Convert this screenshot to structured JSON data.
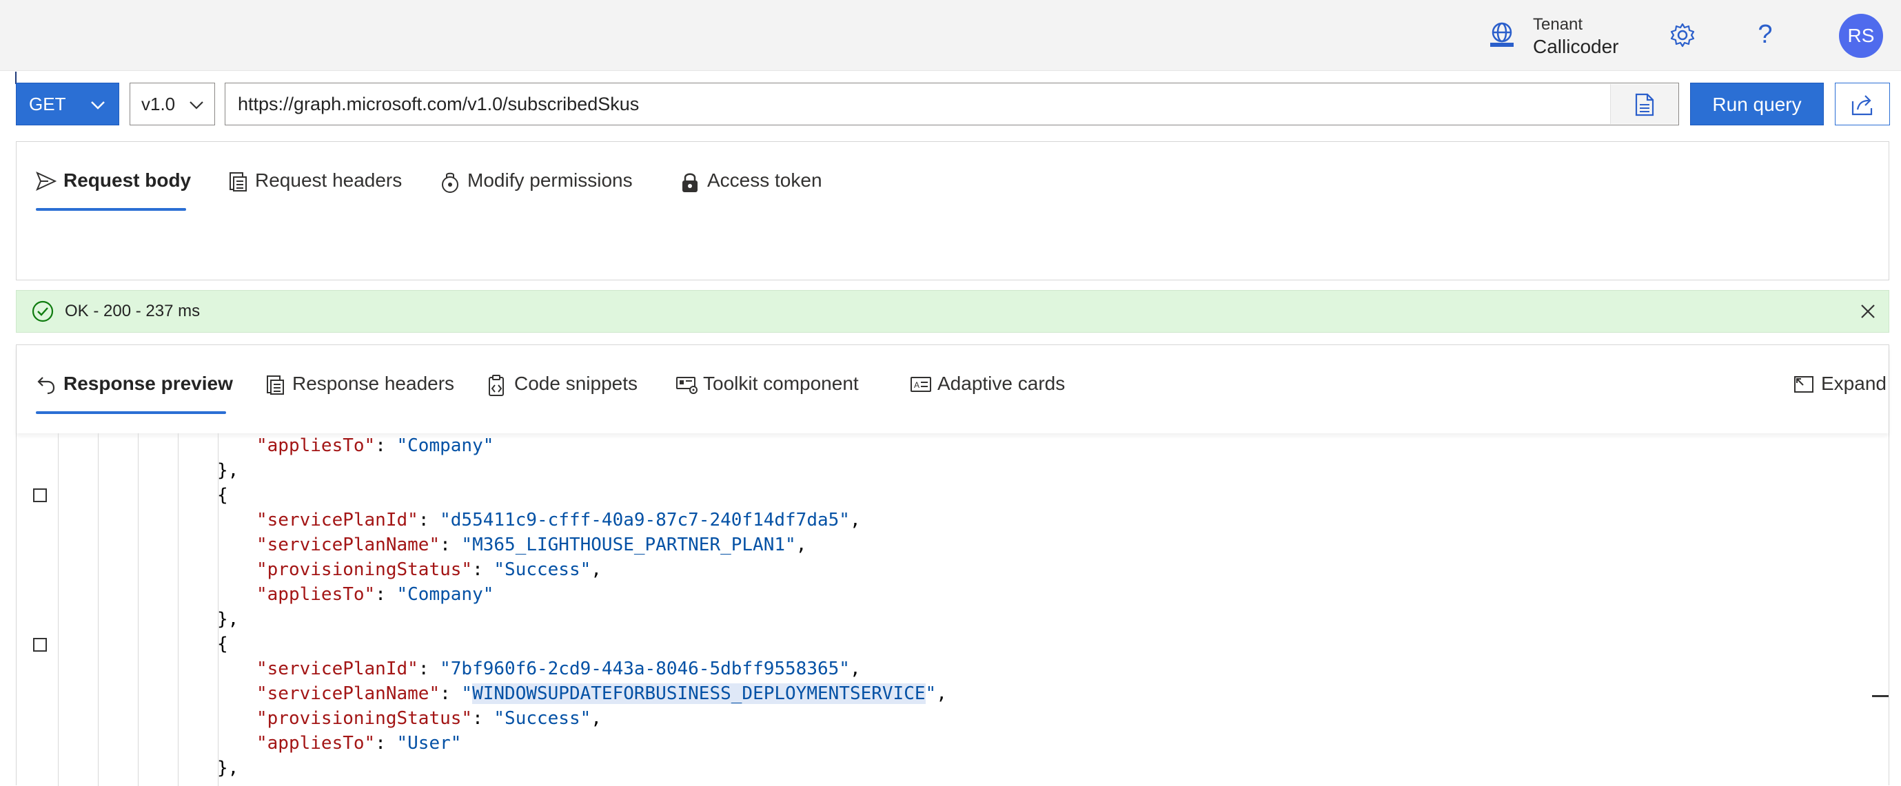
{
  "header": {
    "tenant_label": "Tenant",
    "tenant_name": "Callicoder",
    "avatar_initials": "RS",
    "help_glyph": "?"
  },
  "query": {
    "method": "GET",
    "version": "v1.0",
    "url": "https://graph.microsoft.com/v1.0/subscribedSkus",
    "run_label": "Run query"
  },
  "request_tabs": [
    {
      "label": "Request body",
      "icon": "send-icon",
      "active": true
    },
    {
      "label": "Request headers",
      "icon": "document-icon",
      "active": false
    },
    {
      "label": "Modify permissions",
      "icon": "permissions-icon",
      "active": false
    },
    {
      "label": "Access token",
      "icon": "lock-icon",
      "active": false
    }
  ],
  "status": {
    "text": "OK - 200 - 237 ms",
    "color": "#dff6dd"
  },
  "response_tabs": [
    {
      "label": "Response preview",
      "icon": "undo-icon",
      "active": true
    },
    {
      "label": "Response headers",
      "icon": "document-icon",
      "active": false
    },
    {
      "label": "Code snippets",
      "icon": "code-snippet-icon",
      "active": false
    },
    {
      "label": "Toolkit component",
      "icon": "toolkit-icon",
      "active": false
    },
    {
      "label": "Adaptive cards",
      "icon": "card-icon",
      "active": false
    }
  ],
  "expand_label": "Expand",
  "code": {
    "lines": [
      {
        "key": "\"appliesTo\"",
        "value": "\"Company\"",
        "suffix": ""
      },
      {
        "punct": "},"
      },
      {
        "punct": "{"
      },
      {
        "key": "\"servicePlanId\"",
        "value": "\"d55411c9-cfff-40a9-87c7-240f14df7da5\"",
        "suffix": ","
      },
      {
        "key": "\"servicePlanName\"",
        "value": "\"M365_LIGHTHOUSE_PARTNER_PLAN1\"",
        "suffix": ","
      },
      {
        "key": "\"provisioningStatus\"",
        "value": "\"Success\"",
        "suffix": ","
      },
      {
        "key": "\"appliesTo\"",
        "value": "\"Company\"",
        "suffix": ""
      },
      {
        "punct": "},"
      },
      {
        "punct": "{"
      },
      {
        "key": "\"servicePlanId\"",
        "value": "\"7bf960f6-2cd9-443a-8046-5dbff9558365\"",
        "suffix": ","
      },
      {
        "key": "\"servicePlanName\"",
        "value_open": "\"",
        "value_selected": "WINDOWSUPDATEFORBUSINESS_DEPLOYMENTSERVICE",
        "value_close": "\"",
        "suffix": ","
      },
      {
        "key": "\"provisioningStatus\"",
        "value": "\"Success\"",
        "suffix": ","
      },
      {
        "key": "\"appliesTo\"",
        "value": "\"User\"",
        "suffix": ""
      },
      {
        "punct": "},"
      }
    ]
  },
  "colors": {
    "accent": "#2b6fd4",
    "json_key": "#a31515",
    "json_string": "#0451a5",
    "avatar": "#4f6bed"
  }
}
